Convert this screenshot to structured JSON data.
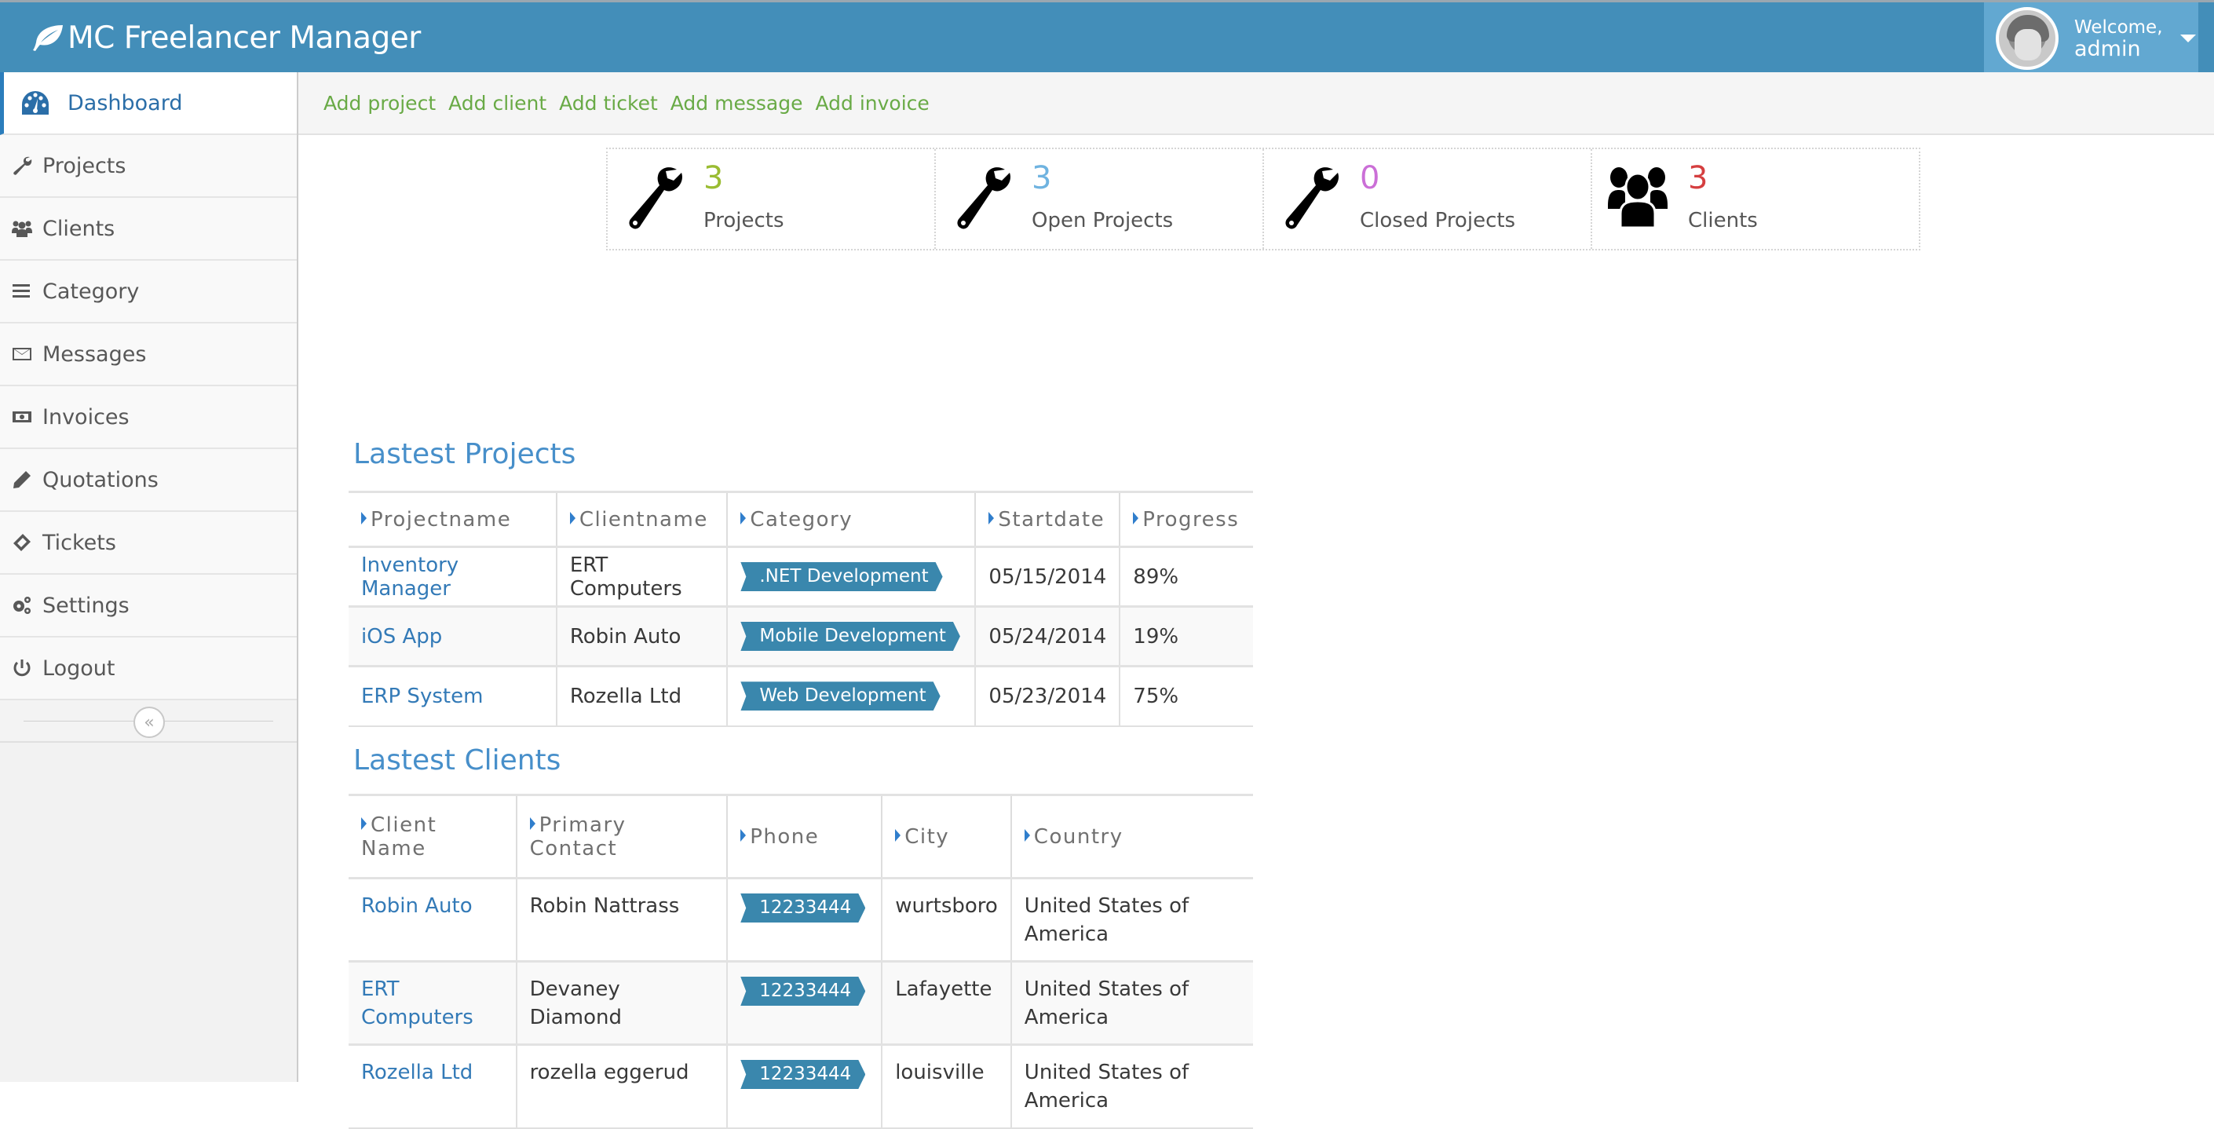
{
  "header": {
    "brand": "MC Freelancer Manager",
    "brand_icon": "leaf-icon",
    "user": {
      "welcome": "Welcome,",
      "name": "admin"
    }
  },
  "sidebar": {
    "items": [
      {
        "label": "Dashboard",
        "icon": "dashboard-icon",
        "active": true
      },
      {
        "label": "Projects",
        "icon": "wrench-icon"
      },
      {
        "label": "Clients",
        "icon": "users-icon"
      },
      {
        "label": "Category",
        "icon": "list-icon"
      },
      {
        "label": "Messages",
        "icon": "envelope-icon"
      },
      {
        "label": "Invoices",
        "icon": "money-icon"
      },
      {
        "label": "Quotations",
        "icon": "pencil-icon"
      },
      {
        "label": "Tickets",
        "icon": "ticket-icon"
      },
      {
        "label": "Settings",
        "icon": "cogs-icon"
      },
      {
        "label": "Logout",
        "icon": "power-icon"
      }
    ],
    "collapse_glyph": "«"
  },
  "toolbar": {
    "links": [
      "Add project",
      "Add client",
      "Add ticket",
      "Add message",
      "Add invoice"
    ]
  },
  "stats": [
    {
      "value": "3",
      "label": "Projects",
      "color": "#9abc32",
      "icon": "wrench-icon"
    },
    {
      "value": "3",
      "label": "Open Projects",
      "color": "#6fb3e0",
      "icon": "wrench-icon"
    },
    {
      "value": "0",
      "label": "Closed Projects",
      "color": "#cb6fd7",
      "icon": "wrench-icon"
    },
    {
      "value": "3",
      "label": "Clients",
      "color": "#d53f40",
      "icon": "users-icon"
    }
  ],
  "projects": {
    "title": "Lastest Projects",
    "columns": [
      "Projectname",
      "Clientname",
      "Category",
      "Startdate",
      "Progress"
    ],
    "rows": [
      {
        "name": "Inventory Manager",
        "client": "ERT Computers",
        "category": ".NET Development",
        "start": "05/15/2014",
        "progress": "89%"
      },
      {
        "name": "iOS App",
        "client": "Robin Auto",
        "category": "Mobile Development",
        "start": "05/24/2014",
        "progress": "19%"
      },
      {
        "name": "ERP System",
        "client": "Rozella Ltd",
        "category": "Web Development",
        "start": "05/23/2014",
        "progress": "75%"
      }
    ]
  },
  "clients": {
    "title": "Lastest Clients",
    "columns": [
      "Client Name",
      "Primary Contact",
      "Phone",
      "City",
      "Country"
    ],
    "rows": [
      {
        "name": "Robin Auto",
        "contact": "Robin Nattrass",
        "phone": "12233444",
        "city": "wurtsboro",
        "country": "United States of America"
      },
      {
        "name": "ERT Computers",
        "contact": "Devaney Diamond",
        "phone": "12233444",
        "city": "Lafayette",
        "country": "United States of America"
      },
      {
        "name": "Rozella Ltd",
        "contact": "rozella eggerud",
        "phone": "12233444",
        "city": "louisville",
        "country": "United States of America"
      }
    ]
  }
}
